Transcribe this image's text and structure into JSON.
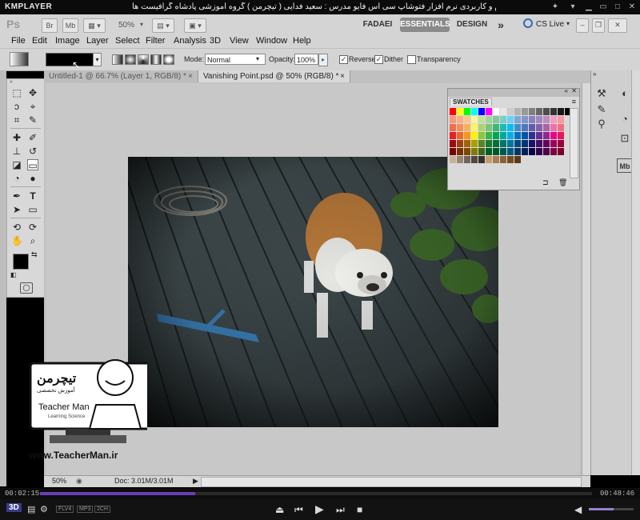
{
  "player": {
    "logo": "KMPLAYER",
    "caption": "مجموعه آموزشی جامع ، گام به گام و کاربردی نرم افزار فتوشاپ سی اس فایو   مدرس : سعید فدایی ( تیچرمن ) گروه آموزشی پادشاه گرافیست ها",
    "time_elapsed": "00:02:15",
    "time_total": "00:48:46",
    "progress_fraction": 0.281,
    "volume_fraction": 0.55,
    "codec_badges": [
      "FLV4",
      "MP3",
      "2CH"
    ],
    "badge_3d": "3D"
  },
  "app_bar": {
    "logo": "Ps",
    "bridge_label": "Br",
    "minibridge_label": "Mb",
    "zoom": "50%",
    "workspaces": [
      "FADAEI",
      "ESSENTIALS",
      "DESIGN"
    ],
    "more": "»",
    "cslive": "CS Live"
  },
  "menu": [
    "File",
    "Edit",
    "Image",
    "Layer",
    "Select",
    "Filter",
    "Analysis",
    "3D",
    "View",
    "Window",
    "Help"
  ],
  "options": {
    "mode_label": "Mode:",
    "mode_value": "Normal",
    "opacity_label": "Opacity:",
    "opacity_value": "100%",
    "reverse_label": "Reverse",
    "reverse_checked": true,
    "dither_label": "Dither",
    "dither_checked": true,
    "transparency_label": "Transparency",
    "transparency_checked": false
  },
  "tabs": [
    {
      "label": "Untitled-1 @ 66.7% (Layer 1, RGB/8) *",
      "close": "×"
    },
    {
      "label": "Vanishing Point.psd @ 50% (RGB/8) *",
      "close": "×"
    }
  ],
  "status": {
    "zoom": "50%",
    "doc": "Doc: 3.01M/3.01M"
  },
  "swatches": {
    "title": "SWATCHES",
    "row1": [
      "#ff0000",
      "#ffff00",
      "#00ff00",
      "#00ffff",
      "#0000ff",
      "#ff00ff",
      "#ffffff",
      "#e6e6e6",
      "#cccccc",
      "#b3b3b3",
      "#999999",
      "#808080",
      "#666666",
      "#4d4d4d",
      "#333333",
      "#1a1a1a",
      "#000000"
    ],
    "rows": [
      [
        "#f7977a",
        "#f9ad81",
        "#fdc68a",
        "#fff79a",
        "#c4df9b",
        "#a3d39c",
        "#82ca9d",
        "#7bcdc8",
        "#6ecff6",
        "#7ea7d8",
        "#8493ca",
        "#8882be",
        "#a187be",
        "#bc8dbf",
        "#f49ac2",
        "#f6989d"
      ],
      [
        "#f26c4f",
        "#f68e55",
        "#fbaf5c",
        "#fff467",
        "#acd372",
        "#7cc576",
        "#3bb878",
        "#1abbb4",
        "#00bff3",
        "#438ccb",
        "#5574b9",
        "#605ca8",
        "#855fa8",
        "#a763a8",
        "#f06ea9",
        "#f26d7d"
      ],
      [
        "#ed1c24",
        "#f26522",
        "#f7941d",
        "#fff200",
        "#8dc73f",
        "#39b54a",
        "#00a651",
        "#00a99d",
        "#00aeef",
        "#0072bc",
        "#0054a6",
        "#2e3192",
        "#662d91",
        "#92278f",
        "#ec008c",
        "#ed145b"
      ],
      [
        "#9e0b0f",
        "#a0410d",
        "#a36209",
        "#aba000",
        "#598527",
        "#1a7b30",
        "#007236",
        "#00746b",
        "#0076a3",
        "#004a80",
        "#003471",
        "#1b1464",
        "#440e62",
        "#630460",
        "#9e005d",
        "#9e0039"
      ],
      [
        "#790000",
        "#7b2e00",
        "#7d4900",
        "#827b00",
        "#406618",
        "#005e20",
        "#005826",
        "#005952",
        "#005b7f",
        "#003663",
        "#002157",
        "#0d004c",
        "#32004b",
        "#4b0049",
        "#7b0046",
        "#7a0026"
      ],
      [
        "#c7b299",
        "#998675",
        "#736357",
        "#534741",
        "#37302d",
        "#c69c6d",
        "#a67c52",
        "#8c6239",
        "#754c24",
        "#603913"
      ]
    ]
  },
  "watermark": {
    "title_fa": "تیچرمن",
    "subtitle_fa": "آموزش تخصصی",
    "name": "Teacher Man",
    "tagline": "Learning Science",
    "url": "www.TeacherMan.ir"
  },
  "colors": {
    "chrome": "#d4d4d4",
    "canvas_bg": "#c0c0c0",
    "player_bg": "#0b0b0b",
    "progress": "#6a3fb5"
  }
}
